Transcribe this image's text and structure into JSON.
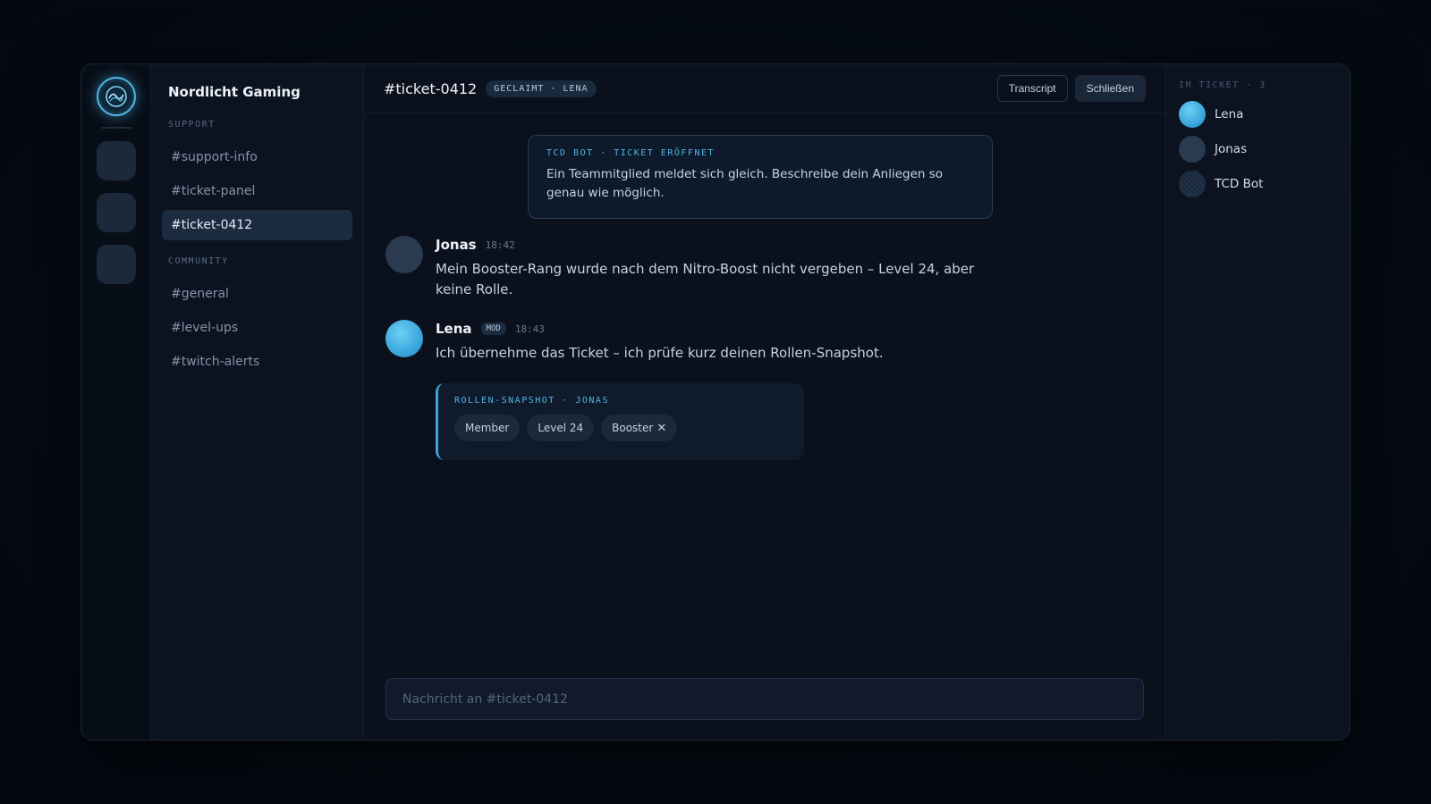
{
  "server": {
    "name": "Nordlicht Gaming",
    "logo_icon": "nordlicht-logo-icon"
  },
  "channels": {
    "categories": [
      {
        "label": "SUPPORT",
        "items": [
          {
            "label": "#support-info",
            "active": false
          },
          {
            "label": "#ticket-panel",
            "active": false
          },
          {
            "label": "#ticket-0412",
            "active": true
          }
        ]
      },
      {
        "label": "COMMUNITY",
        "items": [
          {
            "label": "#general",
            "active": false
          },
          {
            "label": "#level-ups",
            "active": false
          },
          {
            "label": "#twitch-alerts",
            "active": false
          }
        ]
      }
    ]
  },
  "header": {
    "title": "#ticket-0412",
    "badge": "GECLAIMT · LENA",
    "transcript_label": "Transcript",
    "close_label": "Schließen"
  },
  "bot_card": {
    "label": "TCD BOT · TICKET ERÖFFNET",
    "text": "Ein Teammitglied meldet sich gleich. Beschreibe dein Anliegen so genau wie möglich."
  },
  "messages": [
    {
      "author": "Jonas",
      "time": "18:42",
      "badge": "",
      "text": "Mein Booster-Rang wurde nach dem Nitro-Boost nicht vergeben – Level 24, aber keine Rolle."
    },
    {
      "author": "Lena",
      "time": "18:43",
      "badge": "MOD",
      "text": "Ich übernehme das Ticket – ich prüfe kurz deinen Rollen-Snapshot."
    }
  ],
  "snapshot": {
    "label": "ROLLEN-SNAPSHOT · JONAS",
    "chips": [
      "Member",
      "Level 24",
      "Booster"
    ]
  },
  "composer": {
    "placeholder": "Nachricht an #ticket-0412"
  },
  "members": {
    "label": "IM TICKET · 3",
    "list": [
      "Lena",
      "Jonas",
      "TCD Bot"
    ]
  },
  "colors": {
    "accent": "#4fb6e6",
    "background": "#0a111d",
    "active_channel": "#1b2b40"
  }
}
